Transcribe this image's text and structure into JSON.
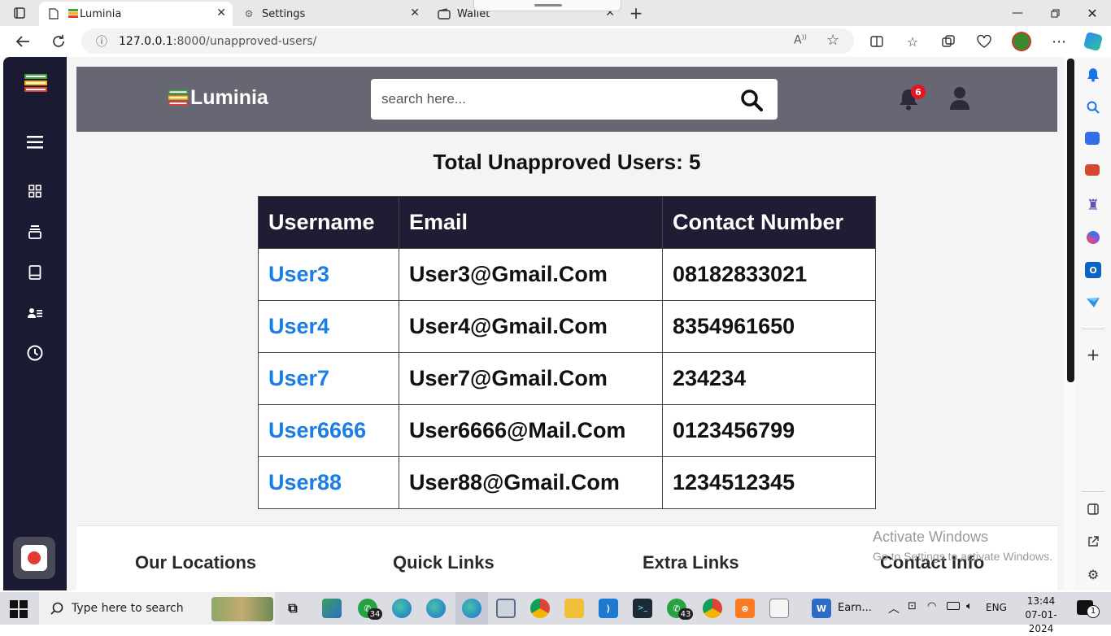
{
  "browser": {
    "tabs": [
      {
        "label": "Luminia",
        "active": true
      },
      {
        "label": "Settings",
        "active": false
      },
      {
        "label": "Wallet",
        "active": false
      }
    ],
    "url_host": "127.0.0.1",
    "url_path": ":8000/unapproved-users/"
  },
  "header": {
    "brand": "Luminia",
    "search_placeholder": "search here...",
    "notification_count": "6"
  },
  "main": {
    "title": "Total Unapproved Users: 5",
    "columns": [
      "Username",
      "Email",
      "Contact Number"
    ],
    "rows": [
      {
        "username": "User3",
        "email": "User3@Gmail.Com",
        "contact": "08182833021"
      },
      {
        "username": "User4",
        "email": "User4@Gmail.Com",
        "contact": "8354961650"
      },
      {
        "username": "User7",
        "email": "User7@Gmail.Com",
        "contact": "234234"
      },
      {
        "username": "User6666",
        "email": "User6666@Mail.Com",
        "contact": "0123456799"
      },
      {
        "username": "User88",
        "email": "User88@Gmail.Com",
        "contact": "1234512345"
      }
    ]
  },
  "footer": {
    "headings": [
      "Our Locations",
      "Quick Links",
      "Extra Links",
      "Contact Info"
    ]
  },
  "watermark": {
    "line1": "Activate Windows",
    "line2": "Go to Settings to activate Windows."
  },
  "taskbar": {
    "search_placeholder": "Type here to search",
    "whatsapp_badge_1": "34",
    "whatsapp_badge_2": "43",
    "app_label": "Earn...",
    "language": "ENG",
    "time": "13:44",
    "date": "07-01-2024",
    "notifications": "1"
  },
  "colors": {
    "sidebar": "#1b1a33",
    "header": "#676673",
    "table_header": "#1e1d33",
    "link": "#1a7ee6",
    "badge": "#e4151f"
  }
}
